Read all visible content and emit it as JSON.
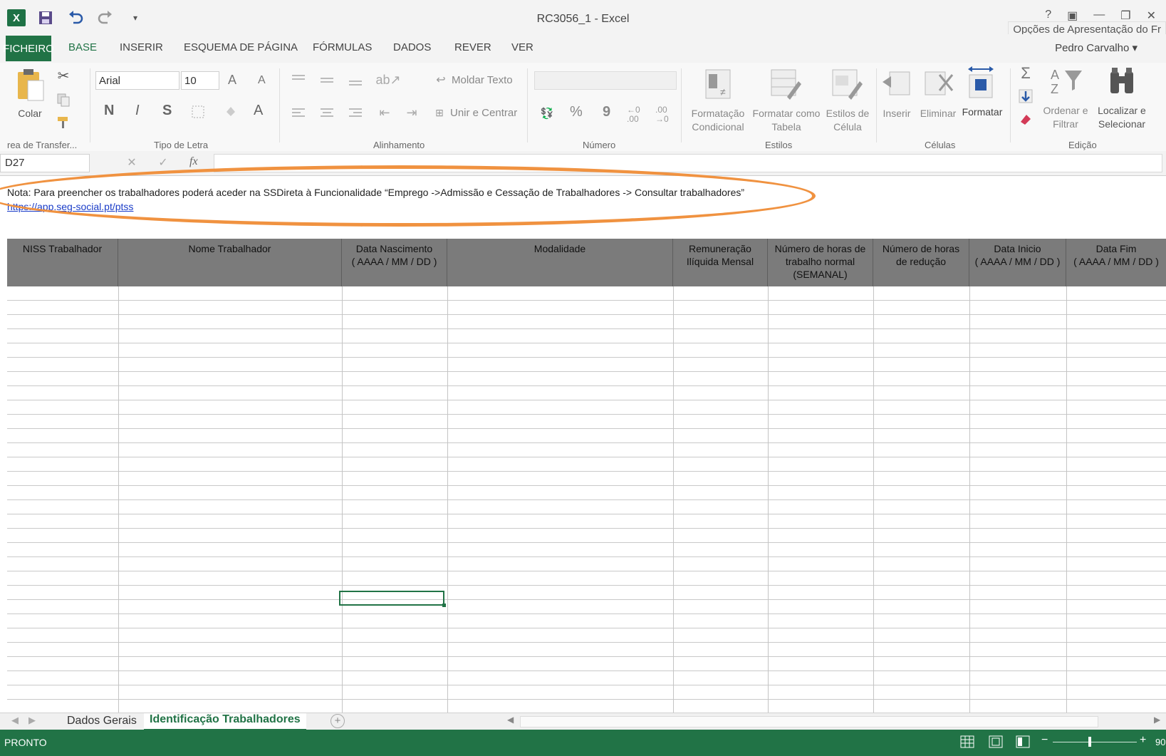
{
  "window": {
    "title": "RC3056_1 - Excel",
    "help": "?",
    "display_options": "Opções de Apresentação do Fr",
    "user": "Pedro Carvalho ▾"
  },
  "tabs": [
    "FICHEIRO",
    "BASE",
    "INSERIR",
    "ESQUEMA DE PÁGINA",
    "FÓRMULAS",
    "DADOS",
    "REVER",
    "VER"
  ],
  "ribbon": {
    "clipboard": {
      "paste": "Colar",
      "group": "rea de Transfer..."
    },
    "font": {
      "name": "Arial",
      "size": "10",
      "bold": "N",
      "italic": "I",
      "underline": "S",
      "grow": "A",
      "shrink": "A",
      "color": "A",
      "group": "Tipo de Letra"
    },
    "alignment": {
      "wrap": "Moldar Texto",
      "merge": "Unir e Centrar",
      "group": "Alinhamento"
    },
    "number": {
      "percent": "%",
      "comma": "9",
      "inc_decimal": "←0 .00",
      "dec_decimal": ".00 →0",
      "group": "Número"
    },
    "styles": {
      "conditional_1": "Formatação",
      "conditional_2": "Condicional",
      "table_1": "Formatar como",
      "table_2": "Tabela",
      "cell_1": "Estilos de",
      "cell_2": "Célula",
      "group": "Estilos"
    },
    "cells": {
      "insert": "Inserir",
      "delete": "Eliminar",
      "format": "Formatar",
      "group": "Células"
    },
    "editing": {
      "sort_1": "Ordenar e",
      "sort_2": "Filtrar",
      "find_1": "Localizar e",
      "find_2": "Selecionar",
      "group": "Edição"
    }
  },
  "formula_bar": {
    "cell_ref": "D27",
    "fx": "fx"
  },
  "sheet": {
    "note": "Nota: Para preencher os trabalhadores poderá aceder na SSDireta à Funcionalidade “Emprego ->Admissão e Cessação de Trabalhadores -> Consultar trabalhadores”",
    "link": "https://app.seg-social.pt/ptss",
    "headers": [
      {
        "l1": "NISS Trabalhador",
        "l2": "",
        "l3": ""
      },
      {
        "l1": "Nome Trabalhador",
        "l2": "",
        "l3": ""
      },
      {
        "l1": "Data Nascimento",
        "l2": "( AAAA / MM / DD )",
        "l3": ""
      },
      {
        "l1": "Modalidade",
        "l2": "",
        "l3": ""
      },
      {
        "l1": "Remuneração",
        "l2": "Ilíquida Mensal",
        "l3": ""
      },
      {
        "l1": "Número de horas de",
        "l2": "trabalho normal",
        "l3": "(SEMANAL)"
      },
      {
        "l1": "Número de horas",
        "l2": "de redução",
        "l3": ""
      },
      {
        "l1": "Data Inicio",
        "l2": "( AAAA / MM / DD )",
        "l3": ""
      },
      {
        "l1": "Data Fim",
        "l2": "( AAAA / MM / DD )",
        "l3": ""
      }
    ]
  },
  "sheet_tabs": [
    "Dados Gerais",
    "Identificação Trabalhadores"
  ],
  "status": {
    "ready": "PRONTO",
    "zoom": "90"
  },
  "colors": {
    "excel_green": "#217346",
    "highlight_orange": "#f09240",
    "header_gray": "#7b7b7b",
    "link_blue": "#1a3cc8"
  },
  "icons": [
    "excel-logo-icon",
    "save-icon",
    "undo-icon",
    "redo-icon",
    "paste-icon",
    "cut-icon",
    "copy-icon",
    "format-painter-icon",
    "autosum-icon",
    "fill-icon",
    "clear-icon",
    "sort-filter-icon",
    "find-icon",
    "normal-view-icon",
    "page-layout-icon",
    "page-break-icon"
  ]
}
